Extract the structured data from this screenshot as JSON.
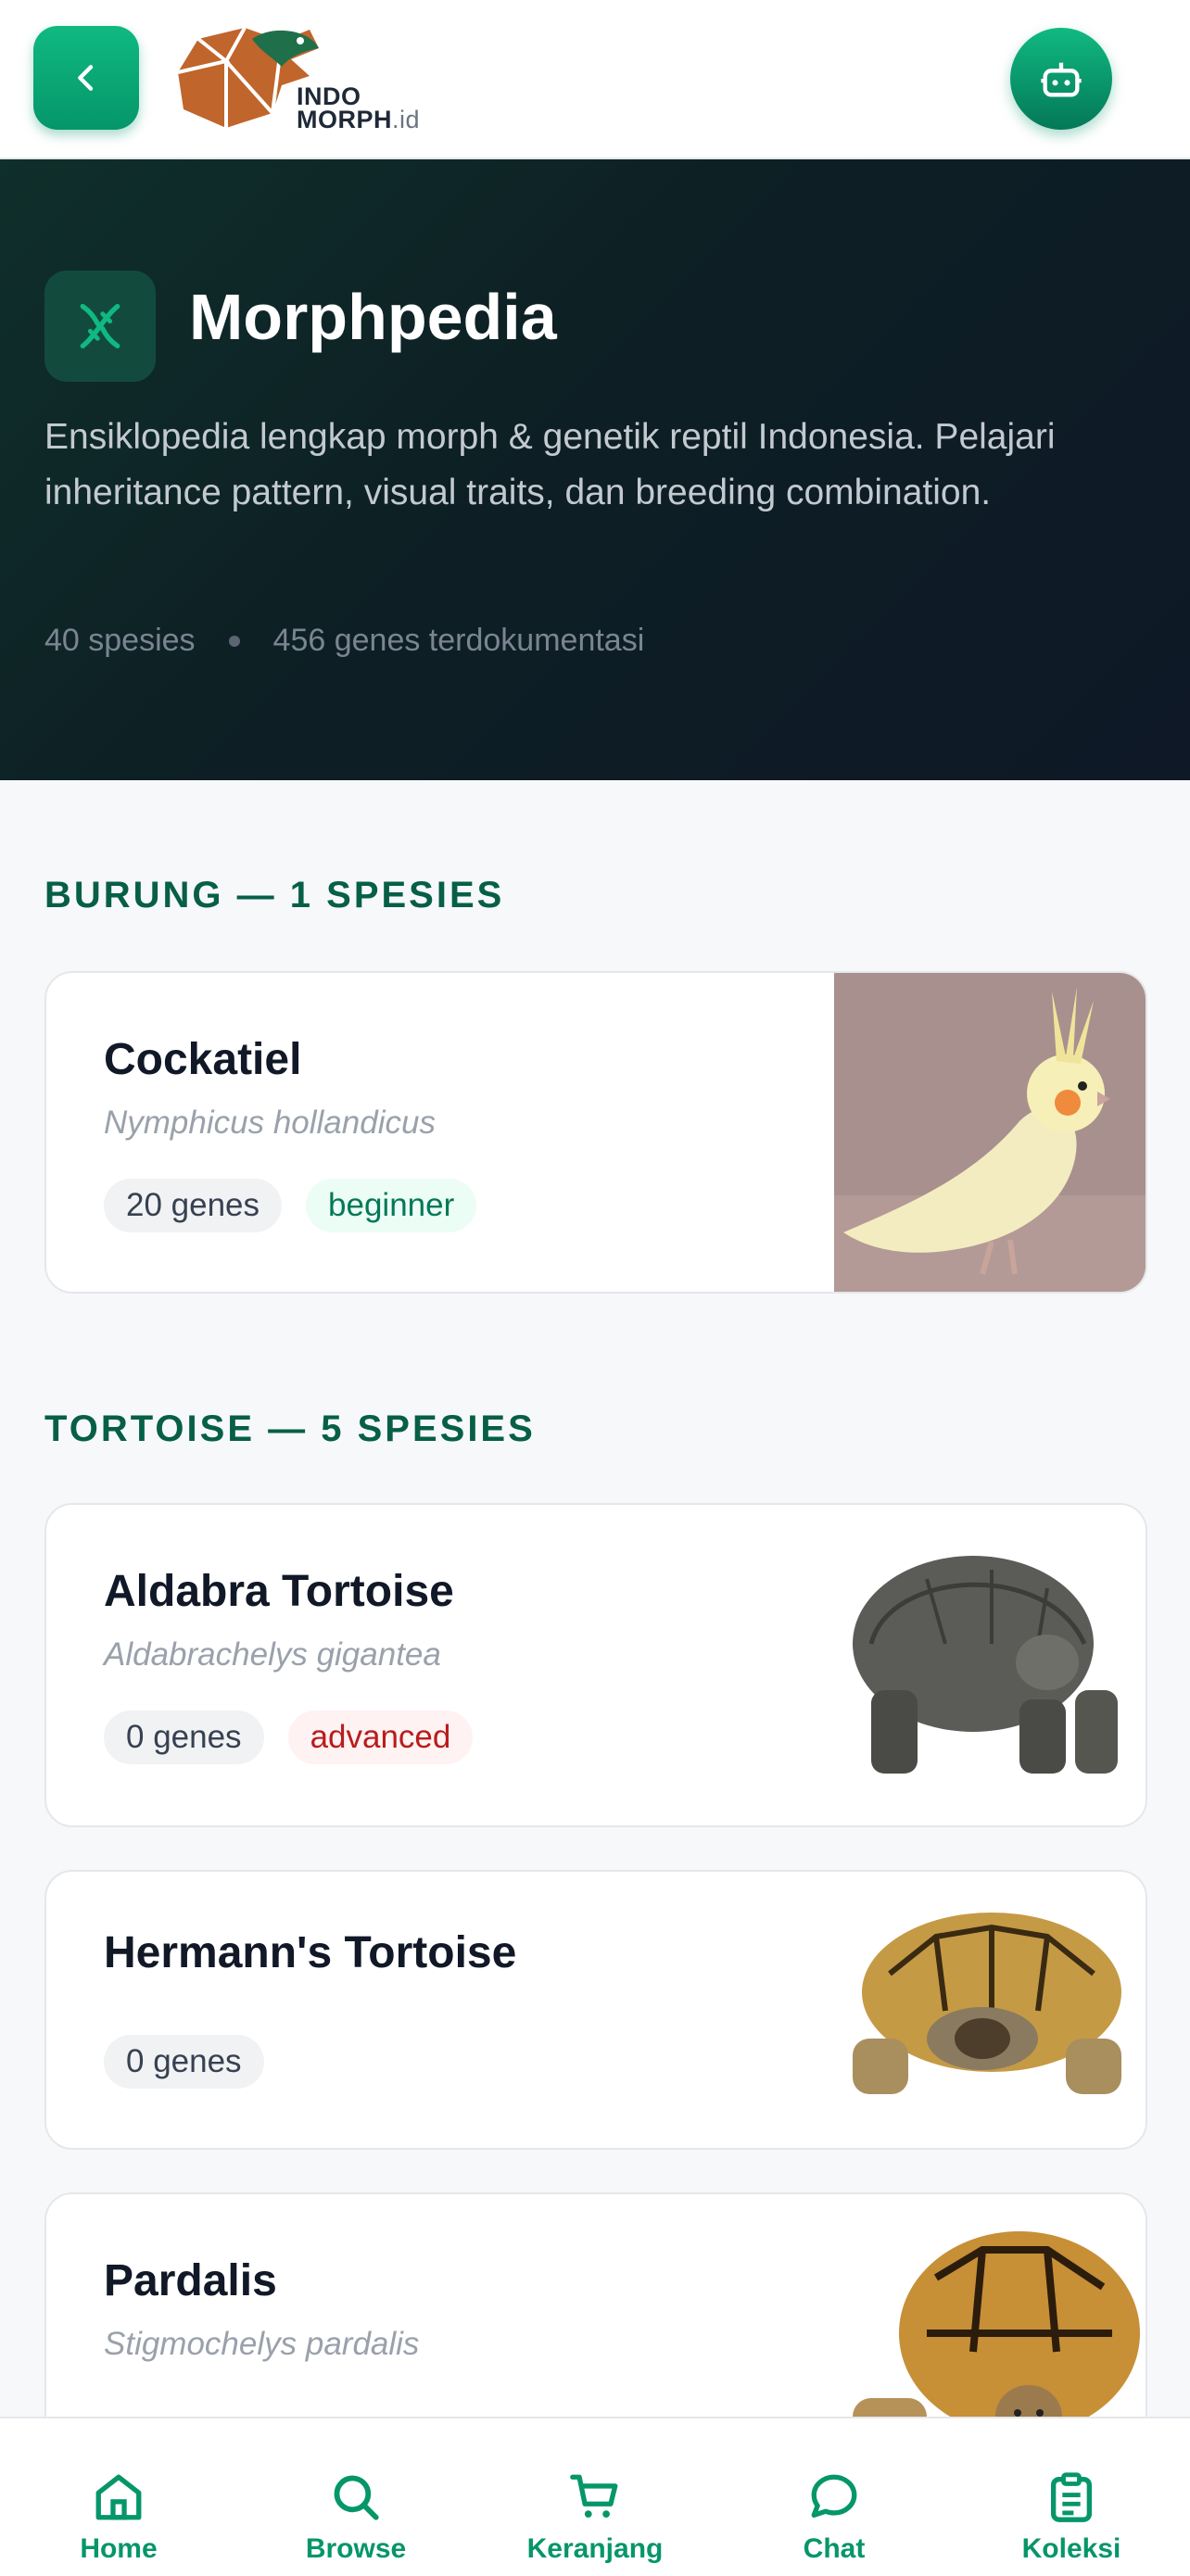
{
  "header": {
    "logo_line1": "INDO",
    "logo_line2": "MORPH",
    "logo_suffix": ".id",
    "back_icon": "chevron-left-icon",
    "assistant_icon": "robot-icon"
  },
  "hero": {
    "title": "Morphpedia",
    "description": "Ensiklopedia lengkap morph & genetik reptil Indonesia. Pelajari inheritance pattern, visual traits, dan breeding combination.",
    "species_count": "40 spesies",
    "genes_count": "456 genes terdokumentasi",
    "icon": "dna-icon"
  },
  "sections": [
    {
      "title": "BURUNG — 1 SPESIES",
      "cards": [
        {
          "name": "Cockatiel",
          "scientific": "Nymphicus hollandicus",
          "genes": "20 genes",
          "level": "beginner"
        }
      ]
    },
    {
      "title": "TORTOISE — 5 SPESIES",
      "cards": [
        {
          "name": "Aldabra Tortoise",
          "scientific": "Aldabrachelys gigantea",
          "genes": "0 genes",
          "level": "advanced"
        },
        {
          "name": "Hermann's Tortoise",
          "scientific": "",
          "genes": "0 genes",
          "level": ""
        },
        {
          "name": "Pardalis",
          "scientific": "Stigmochelys pardalis",
          "genes": "",
          "level": ""
        }
      ]
    }
  ],
  "bottom_nav": {
    "items": [
      {
        "label": "Home",
        "icon": "home-icon"
      },
      {
        "label": "Browse",
        "icon": "search-icon"
      },
      {
        "label": "Keranjang",
        "icon": "cart-icon"
      },
      {
        "label": "Chat",
        "icon": "chat-icon"
      },
      {
        "label": "Koleksi",
        "icon": "clipboard-icon"
      }
    ]
  },
  "colors": {
    "accent": "#059669",
    "section_title": "#065f46",
    "hero_bg": "#0f2f2b"
  }
}
